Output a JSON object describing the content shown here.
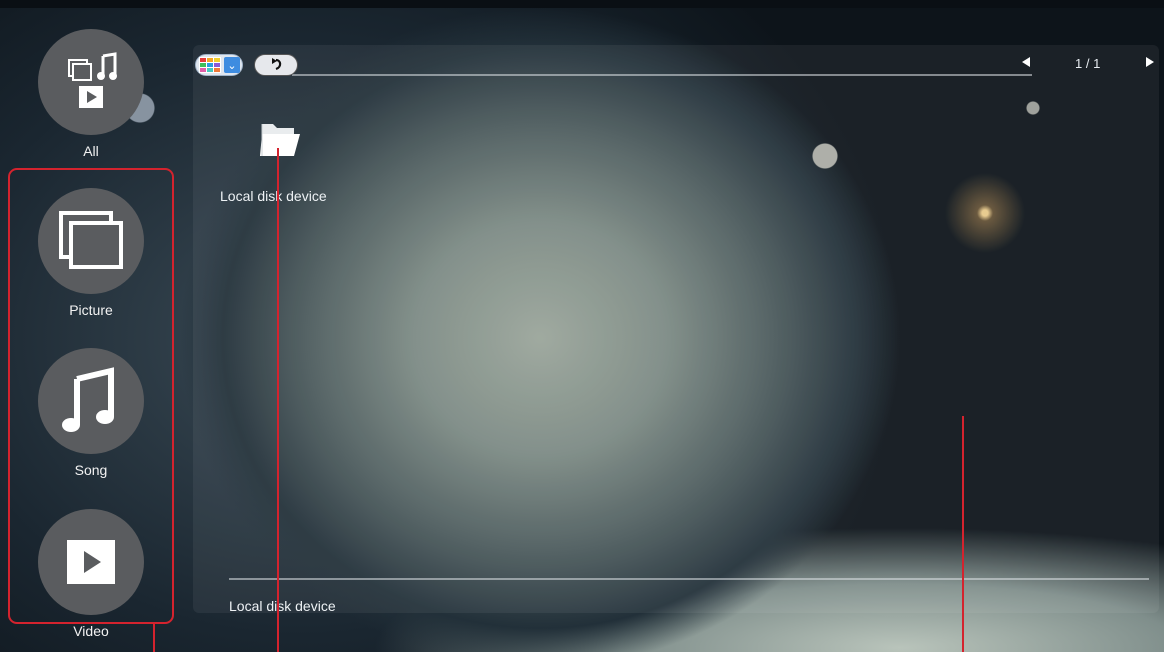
{
  "categories": [
    {
      "label": "All",
      "icon": "all-media-icon"
    },
    {
      "label": "Picture",
      "icon": "picture-icon"
    },
    {
      "label": "Song",
      "icon": "music-note-icon"
    },
    {
      "label": "Video",
      "icon": "play-icon"
    }
  ],
  "toolbar": {
    "view_icon": "grid-view-icon",
    "back_icon": "back-arrow-icon"
  },
  "pager": {
    "text": "1 / 1"
  },
  "files": [
    {
      "label": "Local disk device",
      "icon": "folder-icon"
    }
  ],
  "status_bar": {
    "path": "Local disk device"
  },
  "colors": {
    "annotation": "#d4232e",
    "circle": "#5a5c5f"
  }
}
